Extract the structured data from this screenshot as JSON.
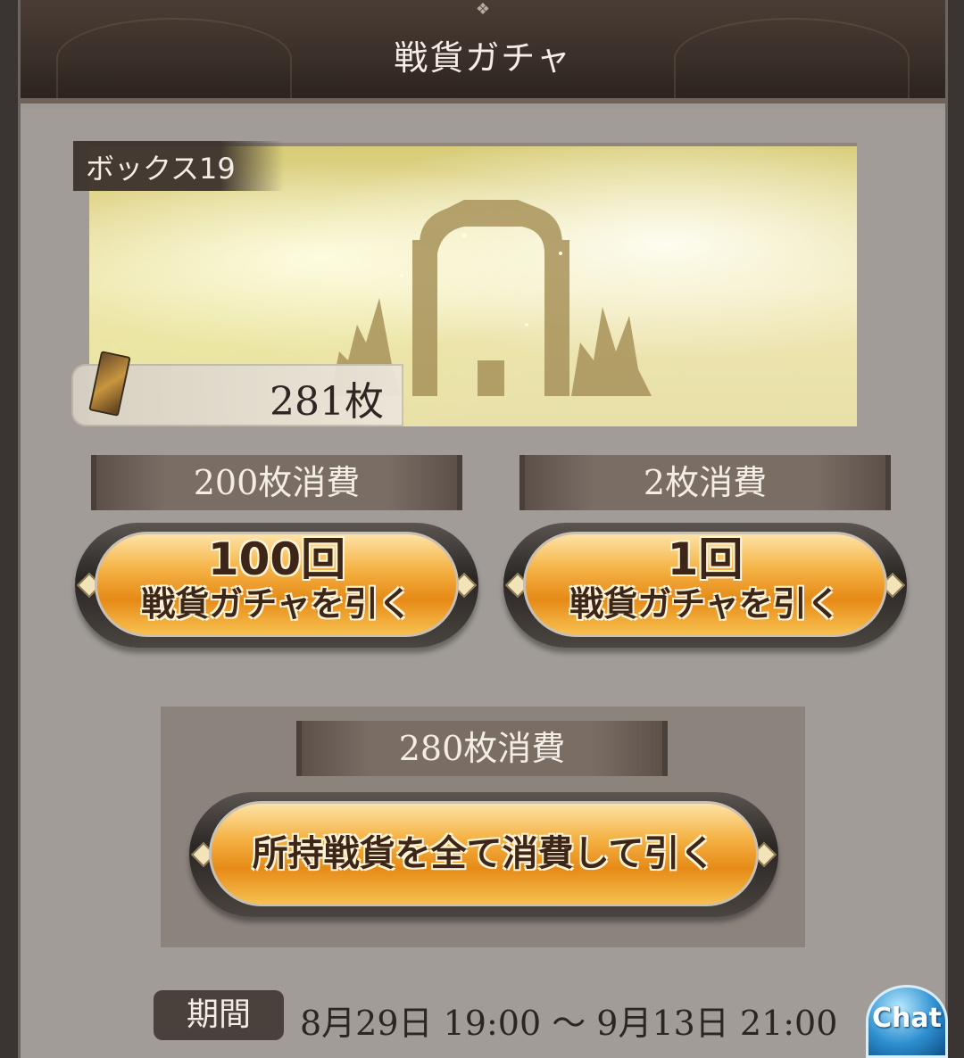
{
  "header": {
    "title": "戦貨ガチャ"
  },
  "banner": {
    "box_label": "ボックス19",
    "count": "281枚"
  },
  "draw_100": {
    "cost": "200枚消費",
    "line1": "100回",
    "line2": "戦貨ガチャを引く"
  },
  "draw_1": {
    "cost": "2枚消費",
    "line1": "1回",
    "line2": "戦貨ガチャを引く"
  },
  "draw_all": {
    "cost": "280枚消費",
    "label": "所持戦貨を全て消費して引く"
  },
  "period": {
    "label": "期間",
    "text": "8月29日 19:00 〜 9月13日 21:00"
  },
  "chat": {
    "label": "Chat"
  },
  "icons": [
    "ticket-icon",
    "gem-ornament-icon"
  ],
  "colors": {
    "button_gold": "#f5b244",
    "header_dark": "#3a2f29",
    "panel": "#a19c97"
  }
}
